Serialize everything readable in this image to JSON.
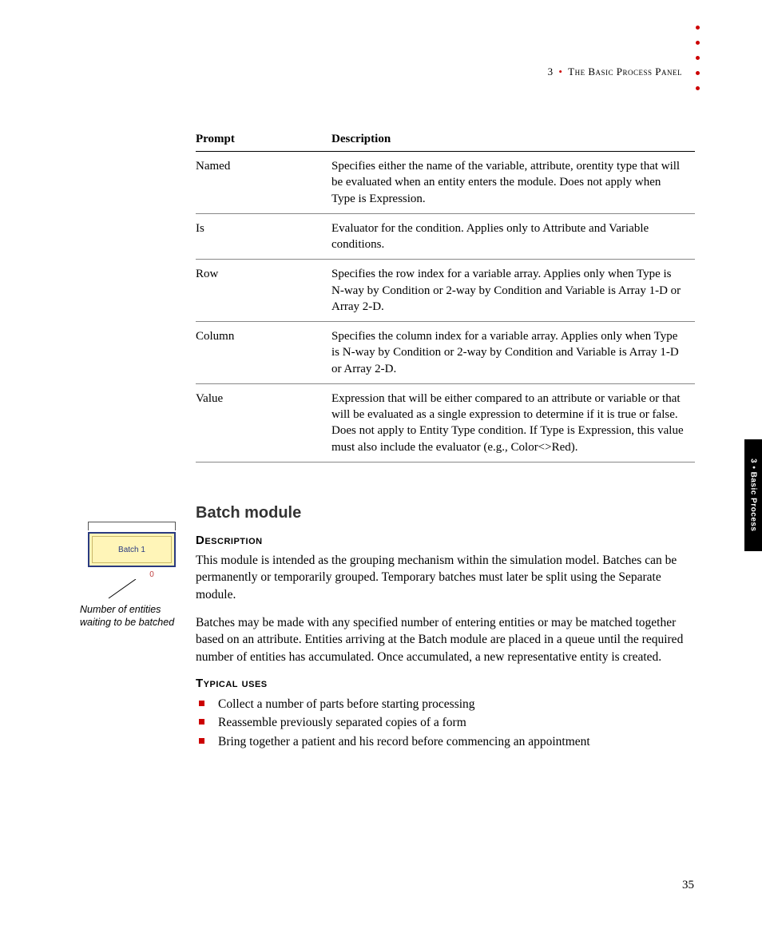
{
  "header": {
    "chapter_num": "3",
    "bullet": "•",
    "chapter_title": "The Basic Process Panel"
  },
  "side_tab": "3 • Basic Process",
  "table": {
    "headers": {
      "prompt": "Prompt",
      "description": "Description"
    },
    "rows": [
      {
        "prompt": "Named",
        "description": "Specifies either the name of the variable, attribute, orentity type that will be evaluated when an entity enters the module. Does not apply when Type is Expression."
      },
      {
        "prompt": "Is",
        "description": "Evaluator for the condition. Applies only to Attribute and Variable conditions."
      },
      {
        "prompt": "Row",
        "description": "Specifies the row index for a variable array. Applies only when Type is N-way by Condition or 2-way by Condition and Variable is Array 1-D or Array 2-D."
      },
      {
        "prompt": "Column",
        "description": "Specifies the column index for a variable array. Applies only when Type is N-way by Condition or 2-way by Condition and Variable is Array 1-D or Array 2-D."
      },
      {
        "prompt": "Value",
        "description": "Expression that will be either compared to an attribute or variable or that will be evaluated as a single expression to determine if it is true or false. Does not apply to Entity Type condition. If Type is Expression, this value must also include the evaluator (e.g., Color<>Red)."
      }
    ]
  },
  "section": {
    "title": "Batch module",
    "description_heading": "Description",
    "para1": "This module is intended as the grouping mechanism within the simulation model. Batches can be permanently or temporarily grouped. Temporary batches must later be split using the Separate module.",
    "para2": "Batches may be made with any specified number of entering entities or may be matched together based on an attribute. Entities arriving at the Batch module are placed in a queue until the required number of entities has accumulated. Once accumulated, a new representative entity is created.",
    "uses_heading": "Typical uses",
    "uses": [
      "Collect a number of parts before starting processing",
      "Reassemble previously separated copies of a form",
      "Bring together a patient and his record before commencing an appointment"
    ]
  },
  "margin_figure": {
    "box_label": "Batch 1",
    "counter": "0",
    "caption": "Number of entities waiting to be batched"
  },
  "page_number": "35"
}
